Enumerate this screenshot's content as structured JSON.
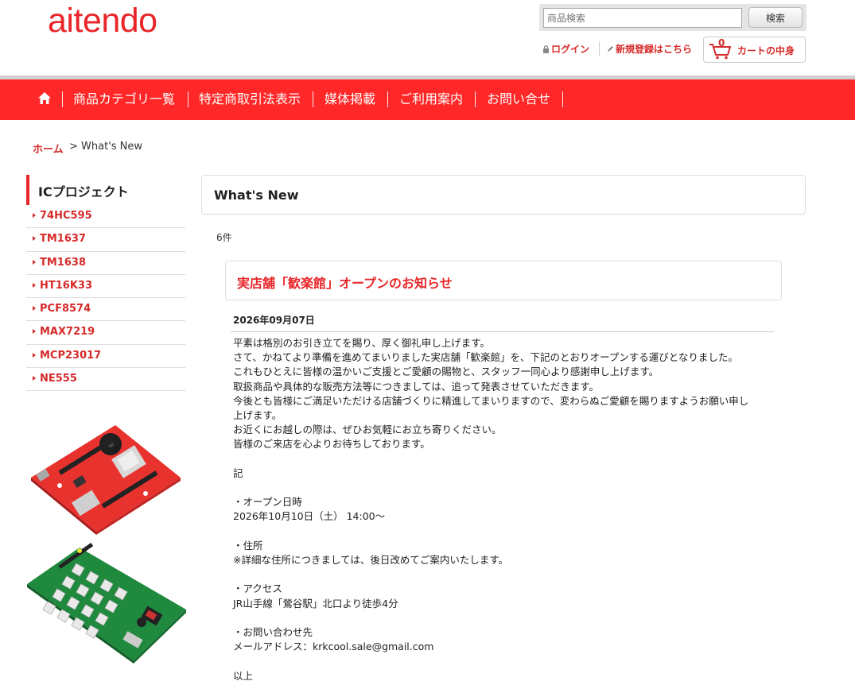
{
  "header": {
    "logo": "aitendo",
    "search_placeholder": "商品検索",
    "search_button": "検索",
    "login": "ログイン",
    "register": "新規登録はこちら",
    "cart_count": "0",
    "cart_label": "カートの中身"
  },
  "nav": {
    "items": [
      "商品カテゴリ一覧",
      "特定商取引法表示",
      "媒体掲載",
      "ご利用案内",
      "お問い合せ"
    ]
  },
  "breadcrumb": {
    "home": "ホーム",
    "separator": ">",
    "current": "What's New"
  },
  "sidebar": {
    "heading": "ICプロジェクト",
    "items": [
      "74HC595",
      "TM1637",
      "TM1638",
      "HT16K33",
      "PCF8574",
      "MAX7219",
      "MCP23017",
      "NE555"
    ]
  },
  "main": {
    "title": "What's New",
    "count": "6件",
    "news": {
      "title": "実店舗「歓楽館」オープンのお知らせ",
      "date": "2026年09月07日",
      "lines": [
        "平素は格別のお引き立てを賜り、厚く御礼申し上げます。",
        "さて、かねてより準備を進めてまいりました実店舗「歓楽館」を、下記のとおりオープンする運びとなりました。",
        "これもひとえに皆様の温かいご支援とご愛顧の賜物と、スタッフ一同心より感謝申し上げます。",
        "取扱商品や具体的な販売方法等につきましては、追って発表させていただきます。",
        "今後とも皆様にご満足いただける店舗づくりに精進してまいりますので、変わらぬご愛顧を賜りますようお願い申し",
        "上げます。",
        "お近くにお越しの際は、ぜひお気軽にお立ち寄りください。",
        "皆様のご来店を心よりお待ちしております。",
        "",
        "記",
        "",
        "・オープン日時",
        "2026年10月10日（土） 14:00～",
        "",
        "・住所",
        "※詳細な住所につきましては、後日改めてご案内いたします。",
        "",
        "・アクセス",
        "JR山手線「鶯谷駅」北口より徒歩4分",
        "",
        "・お問い合わせ先",
        "メールアドレス：krkcool.sale@gmail.com",
        "",
        "以上"
      ]
    }
  },
  "colors": {
    "brand_red": "#ff2727",
    "link_red": "#d62a2a"
  }
}
